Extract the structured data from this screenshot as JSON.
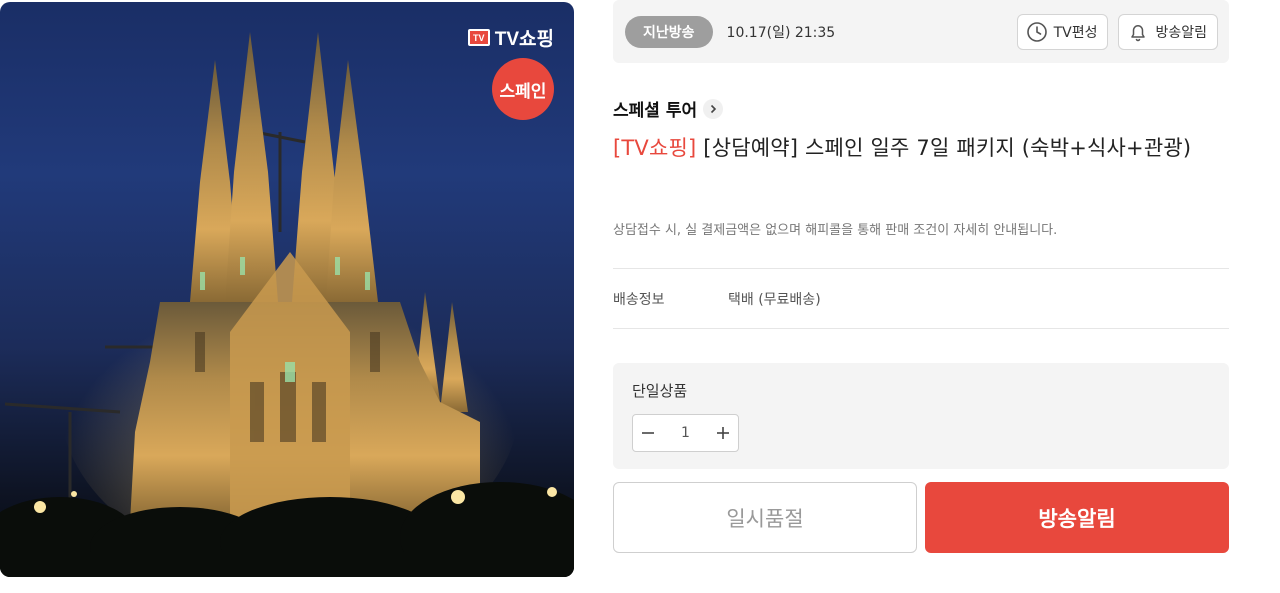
{
  "hero": {
    "channel_badge": "TV쇼핑",
    "channel_box": "TV",
    "region_label": "스페인"
  },
  "broadcast": {
    "status_badge": "지난방송",
    "air_time": "10.17(일) 21:35",
    "schedule_button": "TV편성",
    "alarm_button": "방송알림"
  },
  "product": {
    "category": "스페셜 투어",
    "title_prefix": "[TV쇼핑]",
    "title": " [상담예약] 스페인 일주 7일 패키지 (숙박+식사+관광)",
    "notice": "상담접수 시, 실 결제금액은 없으며 해피콜을 통해 판매 조건이 자세히 안내됩니다."
  },
  "shipping": {
    "label": "배송정보",
    "value": "택배 (무료배송)"
  },
  "option": {
    "name": "단일상품",
    "quantity": "1"
  },
  "actions": {
    "soldout_label": "일시품절",
    "alert_label": "방송알림"
  },
  "colors": {
    "accent": "#e8483d",
    "badge_gray": "#9e9e9e",
    "panel_bg": "#f4f4f4"
  }
}
